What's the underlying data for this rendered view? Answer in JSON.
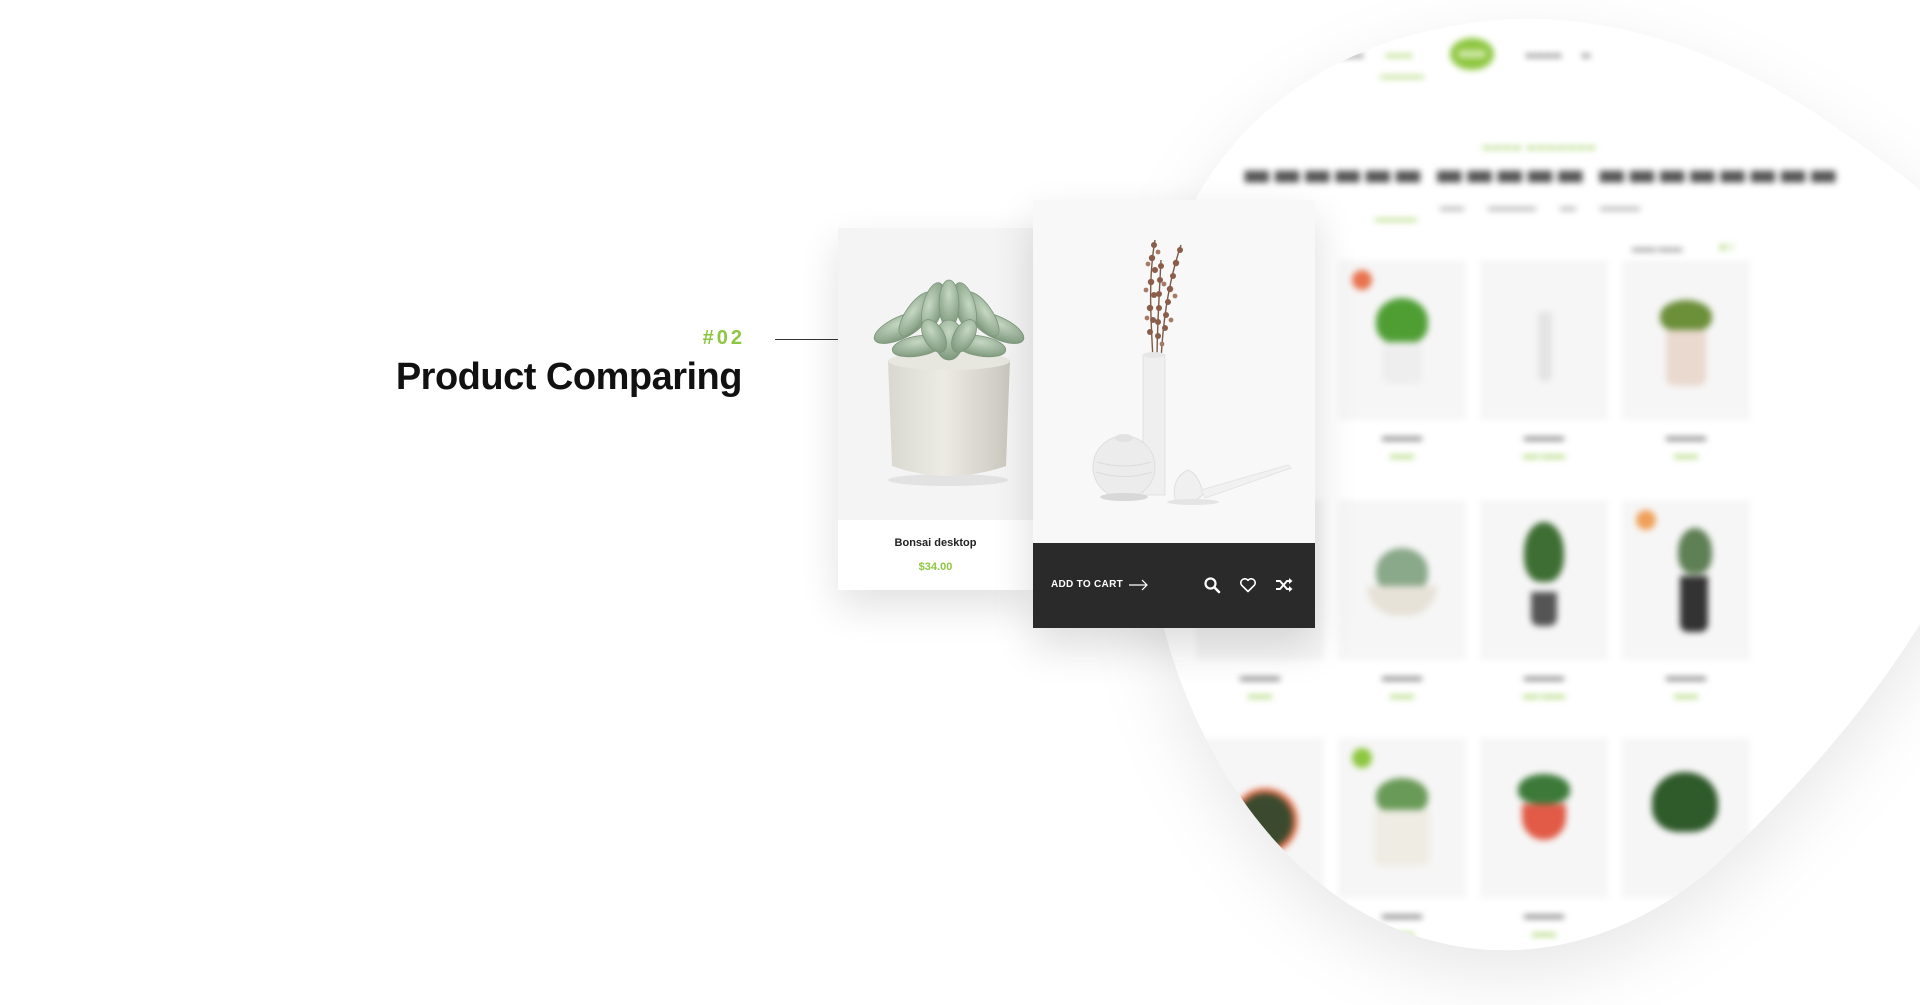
{
  "feature": {
    "number": "#02",
    "title": "Product Comparing"
  },
  "colors": {
    "accent": "#8dc63f",
    "dark_bar": "#2a2a2a",
    "text_dark": "#111111"
  },
  "product_cards": [
    {
      "name": "Bonsai desktop",
      "price": "$34.00"
    },
    {
      "add_to_cart_label": "ADD TO CART",
      "icons": [
        "arrow-right-icon",
        "search-icon",
        "heart-icon",
        "shuffle-icon"
      ]
    }
  ]
}
